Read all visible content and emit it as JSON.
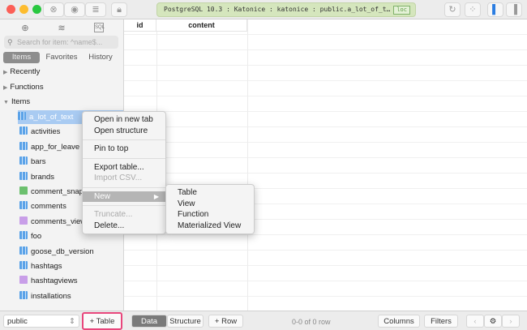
{
  "titlebar": {
    "connection": "PostgreSQL 10.3 : Katonice : katonice : public.a_lot_of_t…",
    "badge": "loc"
  },
  "sidebar": {
    "search_placeholder": "Search for item: ^name$...",
    "tabs": [
      "Items",
      "Favorites",
      "History"
    ],
    "groups": [
      "Recently",
      "Functions",
      "Items"
    ],
    "items": [
      {
        "name": "a_lot_of_text",
        "type": "table"
      },
      {
        "name": "activities",
        "type": "table"
      },
      {
        "name": "app_for_leave",
        "type": "table"
      },
      {
        "name": "bars",
        "type": "table"
      },
      {
        "name": "brands",
        "type": "table"
      },
      {
        "name": "comment_snap",
        "type": "matview"
      },
      {
        "name": "comments",
        "type": "table"
      },
      {
        "name": "comments_view",
        "type": "view"
      },
      {
        "name": "foo",
        "type": "table"
      },
      {
        "name": "goose_db_version",
        "type": "table"
      },
      {
        "name": "hashtags",
        "type": "table"
      },
      {
        "name": "hashtagviews",
        "type": "view"
      },
      {
        "name": "installations",
        "type": "table"
      }
    ]
  },
  "table": {
    "columns": [
      "id",
      "content"
    ]
  },
  "context_menu": {
    "items": [
      {
        "label": "Open in new tab"
      },
      {
        "label": "Open structure"
      },
      {
        "sep": true
      },
      {
        "label": "Pin to top"
      },
      {
        "sep": true
      },
      {
        "label": "Export table..."
      },
      {
        "label": "Import CSV...",
        "disabled": true
      },
      {
        "sep": true
      },
      {
        "label": "New",
        "highlight": true,
        "submenu": true
      },
      {
        "sep": true
      },
      {
        "label": "Truncate...",
        "disabled": true
      },
      {
        "label": "Delete..."
      }
    ]
  },
  "submenu": {
    "items": [
      "Table",
      "View",
      "Function",
      "Materialized View"
    ]
  },
  "bottom": {
    "schema": "public",
    "add_table": "+ Table",
    "data": "Data",
    "structure": "Structure",
    "add_row": "+ Row",
    "row_count": "0-0 of 0 row",
    "columns": "Columns",
    "filters": "Filters"
  },
  "colors": {
    "highlight": "#e8467c",
    "selection": "#a9cbf2",
    "conn_bg": "#d5e6bd"
  }
}
